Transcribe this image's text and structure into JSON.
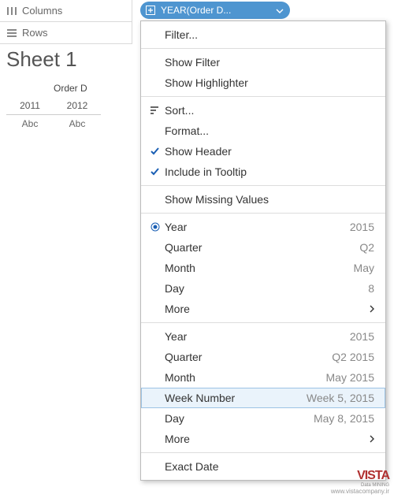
{
  "shelves": {
    "columns_label": "Columns",
    "rows_label": "Rows"
  },
  "pill": {
    "label": "YEAR(Order D..."
  },
  "sheet": {
    "title": "Sheet 1",
    "field_header": "Order D",
    "years": [
      "2011",
      "2012"
    ],
    "placeholders": [
      "Abc",
      "Abc"
    ]
  },
  "menu": {
    "sections": [
      {
        "items": [
          {
            "label": "Filter..."
          }
        ]
      },
      {
        "items": [
          {
            "label": "Show Filter"
          },
          {
            "label": "Show Highlighter"
          }
        ]
      },
      {
        "items": [
          {
            "label": "Sort...",
            "icon": "sort"
          },
          {
            "label": "Format..."
          },
          {
            "label": "Show Header",
            "icon": "check"
          },
          {
            "label": "Include in Tooltip",
            "icon": "check"
          }
        ]
      },
      {
        "items": [
          {
            "label": "Show Missing Values"
          }
        ]
      },
      {
        "items": [
          {
            "label": "Year",
            "value": "2015",
            "icon": "radio"
          },
          {
            "label": "Quarter",
            "value": "Q2"
          },
          {
            "label": "Month",
            "value": "May"
          },
          {
            "label": "Day",
            "value": "8"
          },
          {
            "label": "More",
            "submenu": true
          }
        ]
      },
      {
        "items": [
          {
            "label": "Year",
            "value": "2015"
          },
          {
            "label": "Quarter",
            "value": "Q2 2015"
          },
          {
            "label": "Month",
            "value": "May 2015"
          },
          {
            "label": "Week Number",
            "value": "Week 5, 2015",
            "highlight": true
          },
          {
            "label": "Day",
            "value": "May 8, 2015"
          },
          {
            "label": "More",
            "submenu": true
          }
        ]
      },
      {
        "items": [
          {
            "label": "Exact Date"
          }
        ]
      }
    ]
  },
  "watermark": {
    "logo": "VISTA",
    "sub": "Data MINING",
    "url": "www.vistacompany.ir"
  }
}
